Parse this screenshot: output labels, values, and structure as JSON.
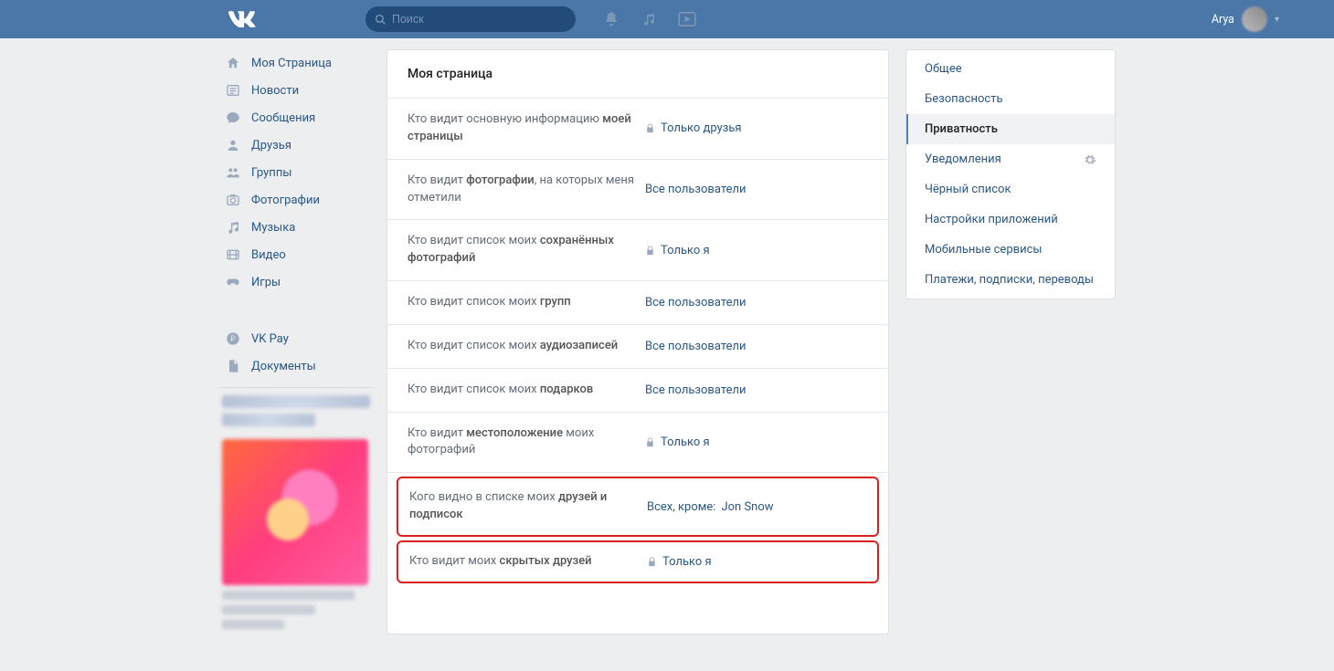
{
  "header": {
    "search_placeholder": "Поиск",
    "username": "Arya"
  },
  "left_nav": [
    {
      "id": "my-page",
      "label": "Моя Страница",
      "icon": "home"
    },
    {
      "id": "news",
      "label": "Новости",
      "icon": "news"
    },
    {
      "id": "messages",
      "label": "Сообщения",
      "icon": "message"
    },
    {
      "id": "friends",
      "label": "Друзья",
      "icon": "friend"
    },
    {
      "id": "groups",
      "label": "Группы",
      "icon": "groups"
    },
    {
      "id": "photos",
      "label": "Фотографии",
      "icon": "photo"
    },
    {
      "id": "music",
      "label": "Музыка",
      "icon": "music"
    },
    {
      "id": "videos",
      "label": "Видео",
      "icon": "video"
    },
    {
      "id": "games",
      "label": "Игры",
      "icon": "games"
    }
  ],
  "left_nav_extra": [
    {
      "id": "vkpay",
      "label": "VK Pay",
      "icon": "vkpay"
    },
    {
      "id": "documents",
      "label": "Документы",
      "icon": "doc"
    }
  ],
  "page_title": "Моя страница",
  "settings": [
    {
      "label_pre": "Кто видит основную информацию ",
      "label_bold": "моей страницы",
      "value": "Только друзья",
      "lock": true
    },
    {
      "label_pre": "Кто видит ",
      "label_bold": "фотографии",
      "label_post": ", на которых меня отметили",
      "value": "Все пользователи",
      "lock": false
    },
    {
      "label_pre": "Кто видит список моих ",
      "label_bold": "сохранённых фотографий",
      "value": "Только я",
      "lock": true
    },
    {
      "label_pre": "Кто видит список моих ",
      "label_bold": "групп",
      "value": "Все пользователи",
      "lock": false
    },
    {
      "label_pre": "Кто видит список моих ",
      "label_bold": "аудиозаписей",
      "value": "Все пользователи",
      "lock": false
    },
    {
      "label_pre": "Кто видит список моих ",
      "label_bold": "подарков",
      "value": "Все пользователи",
      "lock": false
    },
    {
      "label_pre": "Кто видит ",
      "label_bold": "местоположение",
      "label_post": " моих фотографий",
      "value": "Только я",
      "lock": true
    }
  ],
  "highlighted": [
    {
      "label_pre": "Кого видно в списке моих ",
      "label_bold": "друзей и подписок",
      "value": "Всех, кроме: ",
      "value_link": "Jon Snow",
      "lock": false
    },
    {
      "label_pre": "Кто видит моих ",
      "label_bold": "скрытых друзей",
      "value": "Только я",
      "lock": true
    }
  ],
  "right_nav": [
    {
      "id": "general",
      "label": "Общее"
    },
    {
      "id": "security",
      "label": "Безопасность"
    },
    {
      "id": "privacy",
      "label": "Приватность",
      "active": true
    },
    {
      "id": "notifications",
      "label": "Уведомления",
      "gear": true
    },
    {
      "id": "blacklist",
      "label": "Чёрный список"
    },
    {
      "id": "app-settings",
      "label": "Настройки приложений"
    },
    {
      "id": "mobile",
      "label": "Мобильные сервисы"
    },
    {
      "id": "payments",
      "label": "Платежи, подписки, переводы"
    }
  ]
}
